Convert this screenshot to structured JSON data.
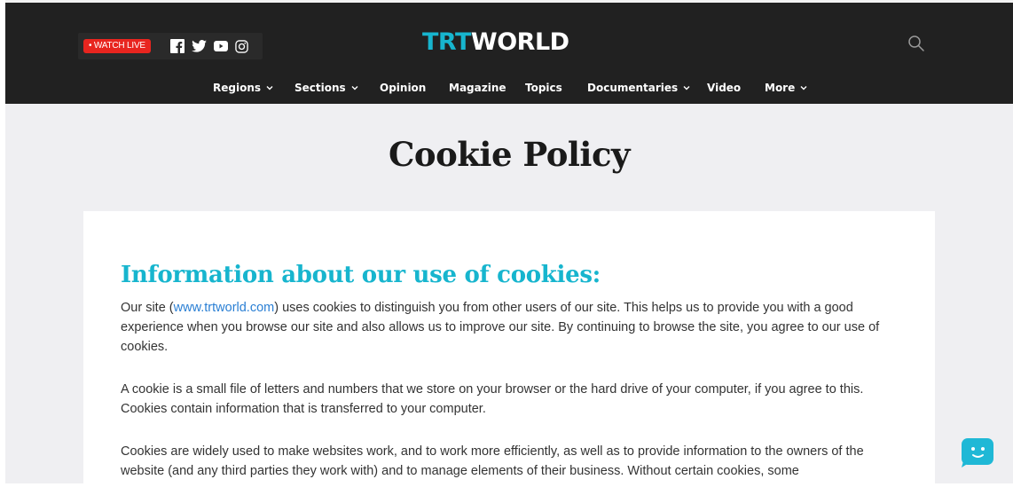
{
  "header": {
    "watch_live": "• WATCH LIVE",
    "logo_trt": "TRT",
    "logo_world": "WORLD",
    "social_icons": [
      "facebook-icon",
      "twitter-icon",
      "youtube-icon",
      "instagram-icon"
    ],
    "nav": [
      {
        "label": "Regions",
        "dropdown": true
      },
      {
        "label": "Sections",
        "dropdown": true
      },
      {
        "label": "Opinion",
        "dropdown": false
      },
      {
        "label": "Magazine",
        "dropdown": false
      },
      {
        "label": "Topics",
        "dropdown": false
      },
      {
        "label": "Documentaries",
        "dropdown": true
      },
      {
        "label": "Video",
        "dropdown": false
      },
      {
        "label": "More",
        "dropdown": true
      }
    ]
  },
  "main": {
    "page_title": "Cookie Policy",
    "section_heading": "Information about our use of cookies:",
    "p1_before": "Our site (",
    "p1_link": "www.trtworld.com",
    "p1_after": ") uses cookies to distinguish you from other users of our site. This helps us to provide you with a good experience when you browse our site and also allows us to improve our site. By continuing to browse the site, you agree to our use of cookies.",
    "p2": "A cookie is a small file of letters and numbers that we store on your browser or the hard drive of your computer, if you agree to this. Cookies contain information that is transferred to your computer.",
    "p3": "Cookies are widely used to make websites work, and to work more efficiently, as well as to provide information to the owners of the website (and any third parties they work with) and to manage elements of their business. Without certain cookies, some"
  },
  "colors": {
    "brand_accent": "#17b5ce",
    "header_bg": "#212121",
    "live_red": "#e8251f",
    "link": "#2a7fd4",
    "page_bg": "#efeff2"
  }
}
